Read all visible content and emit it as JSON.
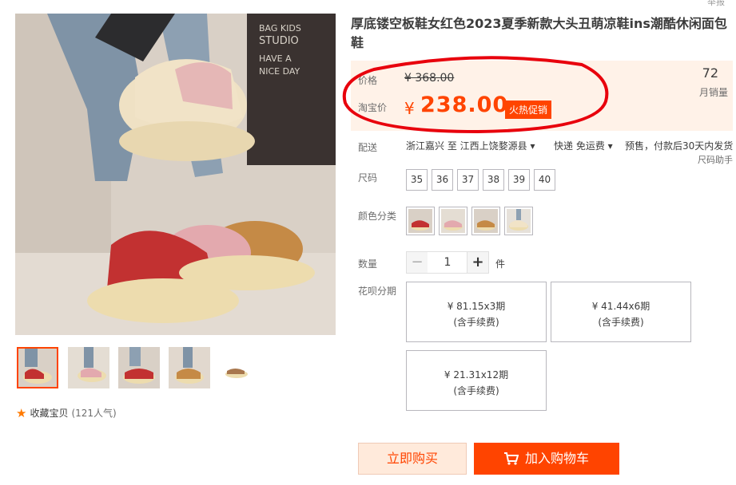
{
  "header": {
    "corner_text": "举报"
  },
  "gallery": {
    "main_image_alt": "",
    "thumbnail_count": 5
  },
  "favorite": {
    "label": "收藏宝贝",
    "count": "(121人气)"
  },
  "product": {
    "title": "厚底镂空板鞋女红色2023夏季新款大头丑萌凉鞋ins潮酷休闲面包鞋"
  },
  "price": {
    "orig_label": "价格",
    "orig_value": "¥ 368.00",
    "taobao_label": "淘宝价",
    "yen": "¥",
    "now_value": "238.00",
    "promo_tag": "火热促销",
    "sales_count": "72",
    "sales_label": "月销量"
  },
  "shipping": {
    "label": "配送",
    "route": "浙江嘉兴 至 江西上饶婺源县 ▾",
    "method": "快递 免运费 ▾",
    "presale": "预售，付款后30天内发货"
  },
  "size_helper": "尺码助手",
  "size": {
    "label": "尺码",
    "options": [
      "35",
      "36",
      "37",
      "38",
      "39",
      "40"
    ]
  },
  "color": {
    "label": "颜色分类"
  },
  "quantity": {
    "label": "数量",
    "minus": "−",
    "value": "1",
    "plus": "+",
    "unit": "件"
  },
  "installment": {
    "label": "花呗分期",
    "options": [
      {
        "amount": "¥ 81.15x3期",
        "fee": "(含手续费)"
      },
      {
        "amount": "¥ 41.44x6期",
        "fee": "(含手续费)"
      },
      {
        "amount": "¥ 21.31x12期",
        "fee": "(含手续费)"
      }
    ]
  },
  "actions": {
    "buy_now": "立即购买",
    "add_cart": "加入购物车"
  },
  "colors": {
    "accent": "#ff4400",
    "price_bg": "#fff2e8",
    "ring": "#e8000c"
  }
}
